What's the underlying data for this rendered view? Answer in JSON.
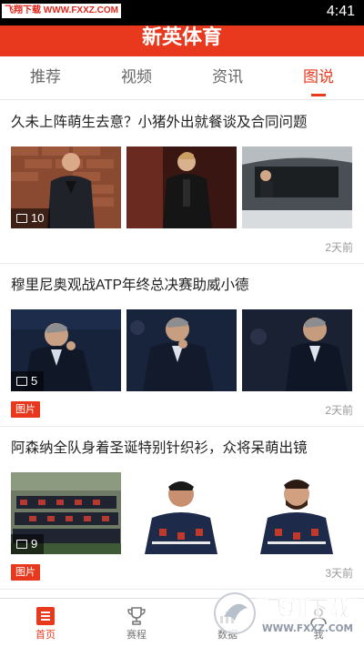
{
  "statusbar": {
    "watermark": "飞翔下载 WWW.FXXZ.COM",
    "time": "4:41"
  },
  "app": {
    "title": "新英体育",
    "accent": "#e8391e"
  },
  "tabs": [
    {
      "label": "推荐",
      "active": false
    },
    {
      "label": "视频",
      "active": false
    },
    {
      "label": "资讯",
      "active": false
    },
    {
      "label": "图说",
      "active": true
    }
  ],
  "articles": [
    {
      "headline": "久未上阵萌生去意？小猪外出就餐谈及合同问题",
      "photo_count": "10",
      "badge": "",
      "time": "2天前"
    },
    {
      "headline": "穆里尼奥观战ATP年终总决赛助威小德",
      "photo_count": "5",
      "badge": "图片",
      "time": "2天前"
    },
    {
      "headline": "阿森纳全队身着圣诞特别针织衫，众将呆萌出镜",
      "photo_count": "9",
      "badge": "图片",
      "time": "3天前"
    }
  ],
  "bottom_nav": [
    {
      "label": "首页",
      "icon": "home-icon",
      "active": true
    },
    {
      "label": "赛程",
      "icon": "trophy-icon",
      "active": false
    },
    {
      "label": "数据",
      "icon": "data-icon",
      "active": false
    },
    {
      "label": "我",
      "icon": "profile-icon",
      "active": false
    }
  ],
  "logo_watermark": {
    "text": "飞翔下载",
    "url": "WWW.FXXZ.COM"
  }
}
